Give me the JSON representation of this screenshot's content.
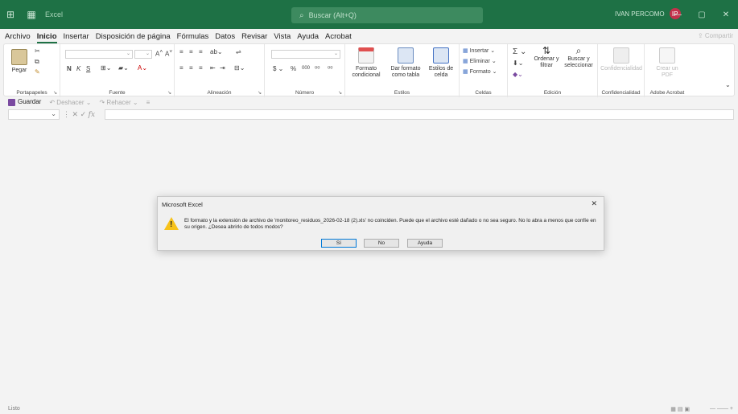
{
  "titlebar": {
    "app_name": "Excel",
    "search_placeholder": "Buscar (Alt+Q)",
    "user_name": "IVAN PERCOMO",
    "user_initial": "IP"
  },
  "menu": {
    "tabs": [
      "Archivo",
      "Inicio",
      "Insertar",
      "Disposición de página",
      "Fórmulas",
      "Datos",
      "Revisar",
      "Vista",
      "Ayuda",
      "Acrobat"
    ],
    "active": "Inicio",
    "share": "Compartir"
  },
  "ribbon": {
    "groups": {
      "clipboard": "Portapapeles",
      "font": "Fuente",
      "alignment": "Alineación",
      "number": "Número",
      "styles": "Estilos",
      "cells": "Celdas",
      "editing": "Edición",
      "confidentiality": "Confidencialidad",
      "adobe": "Adobe Acrobat"
    },
    "paste": "Pegar",
    "bold": "N",
    "italic": "K",
    "underline": "S",
    "currency": "$",
    "percent": "%",
    "thousands": "000",
    "conditional_format": "Formato condicional",
    "format_table": "Dar formato como tabla",
    "cell_styles": "Estilos de celda",
    "insert": "Insertar",
    "delete": "Eliminar",
    "format": "Formato",
    "sort_filter": "Ordenar y filtrar",
    "find_select": "Buscar y seleccionar",
    "confidentiality_btn": "Confidencialidad",
    "create_pdf": "Crear un PDF"
  },
  "qat": {
    "save": "Guardar",
    "undo": "Deshacer",
    "redo": "Rehacer"
  },
  "formula_bar": {
    "fx": "fx"
  },
  "status": {
    "mode": "Listo"
  },
  "dialog": {
    "title": "Microsoft Excel",
    "message": "El formato y la extensión de archivo de 'monitoreo_residuos_2026-02-18 (2).xls' no coinciden. Puede que el archivo esté dañado o no sea seguro. No lo abra a menos que confíe en su origen. ¿Desea abrirlo de todos modos?",
    "buttons": [
      "Sí",
      "No",
      "Ayuda"
    ]
  }
}
